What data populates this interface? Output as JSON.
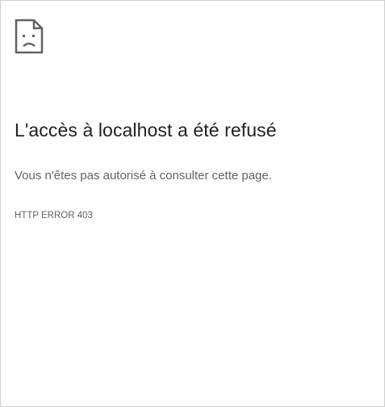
{
  "error_page": {
    "icon": "sad-document-icon",
    "heading": "L'accès à localhost a été refusé",
    "message": "Vous n'êtes pas autorisé à consulter cette page.",
    "error_code": "HTTP ERROR 403"
  },
  "colors": {
    "heading": "#202124",
    "body_text": "#5f6368",
    "icon": "#5f6368",
    "background": "#ffffff",
    "border": "#cfcfcf"
  }
}
